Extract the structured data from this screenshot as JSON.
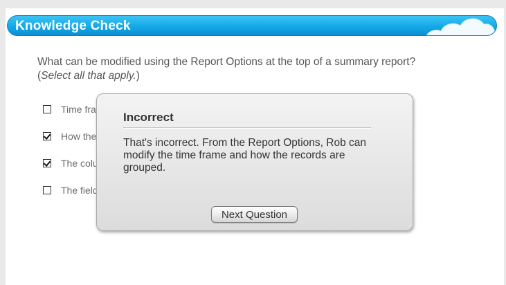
{
  "header": {
    "title": "Knowledge Check",
    "decoration_icon": "cloud-icon",
    "accent_color": "#14a8e8"
  },
  "question": {
    "text": "What can be modified using the Report Options at the top of a summary report?",
    "instruction_prefix": "(",
    "instruction": "Select all that apply.",
    "instruction_suffix": ")"
  },
  "options": [
    {
      "label": "Time fra",
      "checked": false
    },
    {
      "label": "How the",
      "checked": true
    },
    {
      "label": "The colu",
      "checked": true
    },
    {
      "label": "The field",
      "checked": false
    }
  ],
  "feedback": {
    "title": "Incorrect",
    "body": "That's incorrect. From the Report Options, Rob can modify the time frame and how the records are grouped.",
    "button_label": "Next Question"
  }
}
